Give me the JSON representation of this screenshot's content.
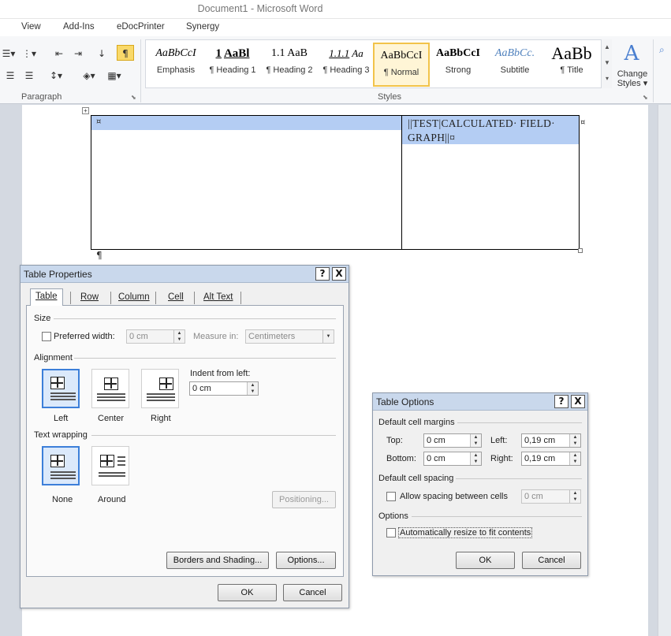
{
  "window": {
    "title": "Document1 - Microsoft Word"
  },
  "menu": [
    "View",
    "Add-Ins",
    "eDocPrinter",
    "Synergy"
  ],
  "ribbon": {
    "groups": {
      "paragraph": "Paragraph",
      "styles": "Styles"
    },
    "styles": [
      {
        "preview": "AaBbCcI",
        "name": "Emphasis"
      },
      {
        "preview": "1",
        "preview2": "AaBl",
        "name": "¶ Heading 1"
      },
      {
        "preview": "1.1",
        "preview2": "AaB",
        "name": "¶ Heading 2"
      },
      {
        "preview": "1.1.1",
        "preview2": "Aa",
        "name": "¶ Heading 3"
      },
      {
        "preview": "AaBbCcI",
        "name": "¶ Normal"
      },
      {
        "preview": "AaBbCcI",
        "name": "Strong"
      },
      {
        "preview": "AaBbCc.",
        "name": "Subtitle"
      },
      {
        "preview": "AaBb",
        "name": "¶ Title"
      }
    ],
    "change_styles": {
      "line1": "Change",
      "line2": "Styles ▾"
    },
    "pilcrow": "¶"
  },
  "document": {
    "cell_mark": "¤",
    "field_text": "||TEST|CALCULATED· FIELD· GRAPH||¤",
    "end_cell_mark": "¤",
    "paragraph_mark": "¶",
    "move_handle": "+"
  },
  "table_properties": {
    "title": "Table Properties",
    "help": "?",
    "close": "X",
    "tabs": [
      "Table",
      "Row",
      "Column",
      "Cell",
      "Alt Text"
    ],
    "size_label": "Size",
    "preferred_width_label": "Preferred width:",
    "preferred_width_value": "0 cm",
    "measure_in_label": "Measure in:",
    "measure_in_value": "Centimeters",
    "alignment_label": "Alignment",
    "alignments": [
      "Left",
      "Center",
      "Right"
    ],
    "indent_label": "Indent from left:",
    "indent_value": "0 cm",
    "text_wrapping_label": "Text wrapping",
    "wrapping": [
      "None",
      "Around"
    ],
    "positioning_btn": "Positioning...",
    "borders_btn": "Borders and Shading...",
    "options_btn": "Options...",
    "ok": "OK",
    "cancel": "Cancel"
  },
  "table_options": {
    "title": "Table Options",
    "help": "?",
    "close": "X",
    "margins_label": "Default cell margins",
    "top_label": "Top:",
    "top_value": "0 cm",
    "left_label": "Left:",
    "left_value": "0,19 cm",
    "bottom_label": "Bottom:",
    "bottom_value": "0 cm",
    "right_label": "Right:",
    "right_value": "0,19 cm",
    "spacing_label": "Default cell spacing",
    "allow_spacing_label": "Allow spacing between cells",
    "spacing_value": "0 cm",
    "options_label": "Options",
    "auto_resize_label": "Automatically resize to fit contents",
    "ok": "OK",
    "cancel": "Cancel"
  }
}
